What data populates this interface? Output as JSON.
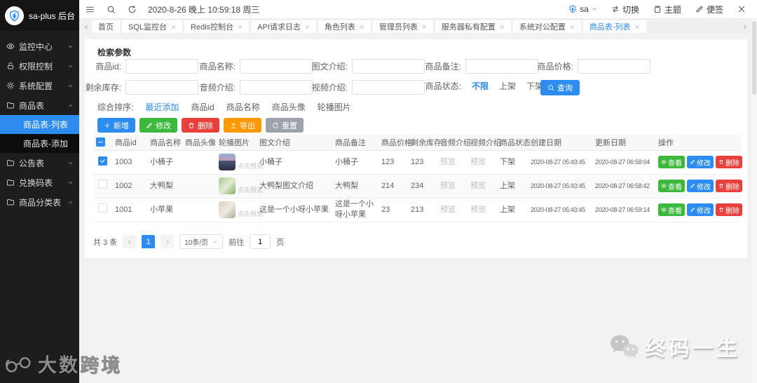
{
  "app": {
    "logo_text": "sa-plus 后台"
  },
  "topbar": {
    "datetime": "2020-8-26 晚上 10:59:18 周三",
    "username": "sa",
    "switch_label": "切换",
    "theme_label": "主题",
    "note_label": "便签"
  },
  "tabbar": {
    "tabs": [
      {
        "label": "首页",
        "closable": false,
        "active": false
      },
      {
        "label": "SQL监控台",
        "closable": true,
        "active": false
      },
      {
        "label": "Redis控制台",
        "closable": true,
        "active": false
      },
      {
        "label": "API请求日志",
        "closable": true,
        "active": false
      },
      {
        "label": "角色列表",
        "closable": true,
        "active": false
      },
      {
        "label": "管理员列表",
        "closable": true,
        "active": false
      },
      {
        "label": "服务器私有配置",
        "closable": true,
        "active": false
      },
      {
        "label": "系统对公配置",
        "closable": true,
        "active": false
      },
      {
        "label": "商品表-列表",
        "closable": true,
        "active": true
      }
    ]
  },
  "sidebar": {
    "items": [
      {
        "label": "监控中心",
        "icon": "eye-icon",
        "expanded": false
      },
      {
        "label": "权限控制",
        "icon": "lock-icon",
        "expanded": false
      },
      {
        "label": "系统配置",
        "icon": "gear-icon",
        "expanded": false
      },
      {
        "label": "商品表",
        "icon": "folder-icon",
        "expanded": true
      },
      {
        "label": "商品表-列表",
        "active": true
      },
      {
        "label": "商品表-添加",
        "active": false
      },
      {
        "label": "公告表",
        "icon": "folder-icon",
        "expanded": false
      },
      {
        "label": "兑换码表",
        "icon": "folder-icon",
        "expanded": false
      },
      {
        "label": "商品分类表",
        "icon": "folder-icon",
        "expanded": false
      }
    ]
  },
  "search": {
    "title": "检索参数",
    "labels": {
      "id": "商品id:",
      "name": "商品名称:",
      "intro": "图文介绍:",
      "remark": "商品备注:",
      "price": "商品价格:",
      "stock": "剩余库存:",
      "audio": "音频介绍:",
      "video": "视频介绍:",
      "status": "商品状态:"
    },
    "status_options": [
      "不限",
      "上架",
      "下架"
    ],
    "status_active": "不限",
    "query_button": "查询",
    "sort_label": "综合排序:",
    "sort_options": [
      "最近添加",
      "商品id",
      "商品名称",
      "商品头像",
      "轮播图片"
    ],
    "sort_active": "最近添加"
  },
  "toolbar": {
    "add": "新增",
    "edit": "修改",
    "delete": "删除",
    "export": "导出",
    "reset": "重置"
  },
  "table": {
    "header_checkbox": "indeterminate",
    "columns": {
      "id": "商品id",
      "name": "商品名称",
      "avatar": "商品头像",
      "carousel": "轮播图片",
      "intro": "图文介绍",
      "remark": "商品备注",
      "price": "商品价格",
      "stock": "剩余库存",
      "audio": "音频介绍",
      "video": "视频介绍",
      "status": "商品状态",
      "created": "创建日期",
      "updated": "更新日期",
      "actions": "操作"
    },
    "click_preview": "点击预览",
    "actions": {
      "view": "查看",
      "edit": "修改",
      "delete": "删除"
    },
    "rows": [
      {
        "checked": true,
        "id": "1003",
        "name": "小桶子",
        "intro": "小桶子",
        "remark": "小桶子",
        "price": "123",
        "stock": "123",
        "audio": "预览",
        "video": "预览",
        "status": "下架",
        "created": "2020-08-27 05:43:45",
        "updated": "2020-08-27 06:58:04"
      },
      {
        "checked": false,
        "id": "1002",
        "name": "大鸭梨",
        "intro": "大鸭梨图文介绍",
        "remark": "大鸭梨",
        "price": "214",
        "stock": "234",
        "audio": "预览",
        "video": "预览",
        "status": "上架",
        "created": "2020-08-27 05:43:45",
        "updated": "2020-08-27 06:58:42"
      },
      {
        "checked": false,
        "id": "1001",
        "name": "小苹果",
        "intro": "这是一个小呀小苹果",
        "remark": "这是一个小呀小苹果",
        "price": "23",
        "stock": "213",
        "audio": "预览",
        "video": "预览",
        "status": "上架",
        "created": "2020-08-27 05:43:45",
        "updated": "2020-08-27 06:59:14"
      }
    ]
  },
  "pagination": {
    "total": "共 3 条",
    "page": "1",
    "page_size": "10条/页",
    "goto": "前往",
    "goto_value": "1",
    "unit": "页"
  },
  "watermarks": {
    "left": "大数跨境",
    "right": "终码一生"
  },
  "colors": {
    "primary": "#2d8cf0",
    "success": "#3cb93c",
    "danger": "#e8413c",
    "warning": "#ff9900",
    "neutral": "#9ea3ab",
    "sidebar_bg": "#1d1d1d"
  }
}
